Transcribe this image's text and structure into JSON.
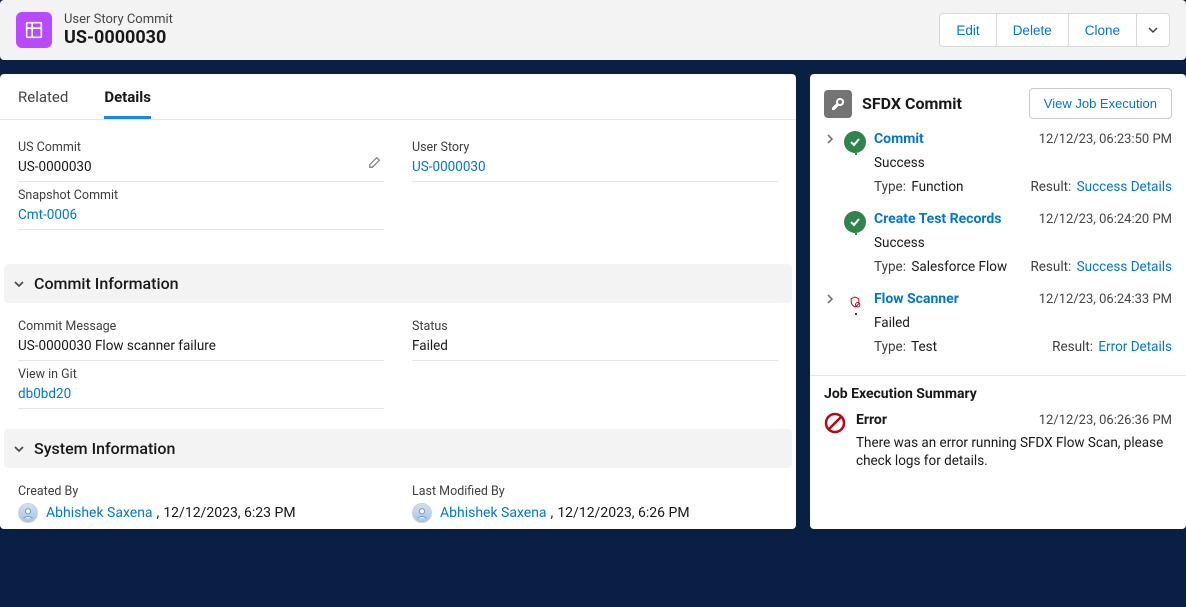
{
  "header": {
    "record_type": "User Story Commit",
    "record_title": "US-0000030",
    "actions": {
      "edit": "Edit",
      "delete": "Delete",
      "clone": "Clone"
    }
  },
  "tabs": {
    "related": "Related",
    "details": "Details",
    "active": "details"
  },
  "details": {
    "us_commit": {
      "label": "US Commit",
      "value": "US-0000030"
    },
    "user_story": {
      "label": "User Story",
      "value": "US-0000030"
    },
    "snapshot_commit": {
      "label": "Snapshot Commit",
      "value": "Cmt-0006"
    }
  },
  "sections": {
    "commit_info": {
      "title": "Commit Information",
      "commit_message": {
        "label": "Commit Message",
        "value": "US-0000030 Flow scanner failure"
      },
      "status": {
        "label": "Status",
        "value": "Failed"
      },
      "view_in_git": {
        "label": "View in Git",
        "value": "db0bd20"
      }
    },
    "system_info": {
      "title": "System Information",
      "created_by": {
        "label": "Created By",
        "user": "Abhishek Saxena",
        "timestamp": "12/12/2023, 6:23 PM"
      },
      "modified_by": {
        "label": "Last Modified By",
        "user": "Abhishek Saxena",
        "timestamp": "12/12/2023, 6:26 PM"
      }
    }
  },
  "panel": {
    "title": "SFDX Commit",
    "action": "View Job Execution",
    "type_label": "Type:",
    "result_label": "Result:",
    "steps": [
      {
        "name": "Commit",
        "time": "12/12/23, 06:23:50 PM",
        "status": "Success",
        "type": "Function",
        "result": "Success Details",
        "state": "success"
      },
      {
        "name": "Create Test Records",
        "time": "12/12/23, 06:24:20 PM",
        "status": "Success",
        "type": "Salesforce Flow",
        "result": "Success Details",
        "state": "success"
      },
      {
        "name": "Flow Scanner",
        "time": "12/12/23, 06:24:33 PM",
        "status": "Failed",
        "type": "Test",
        "result": "Error Details",
        "state": "failed"
      }
    ],
    "summary": {
      "title": "Job Execution Summary",
      "label": "Error",
      "time": "12/12/23, 06:26:36 PM",
      "message": "There was an error running SFDX Flow Scan, please check logs for details."
    }
  }
}
